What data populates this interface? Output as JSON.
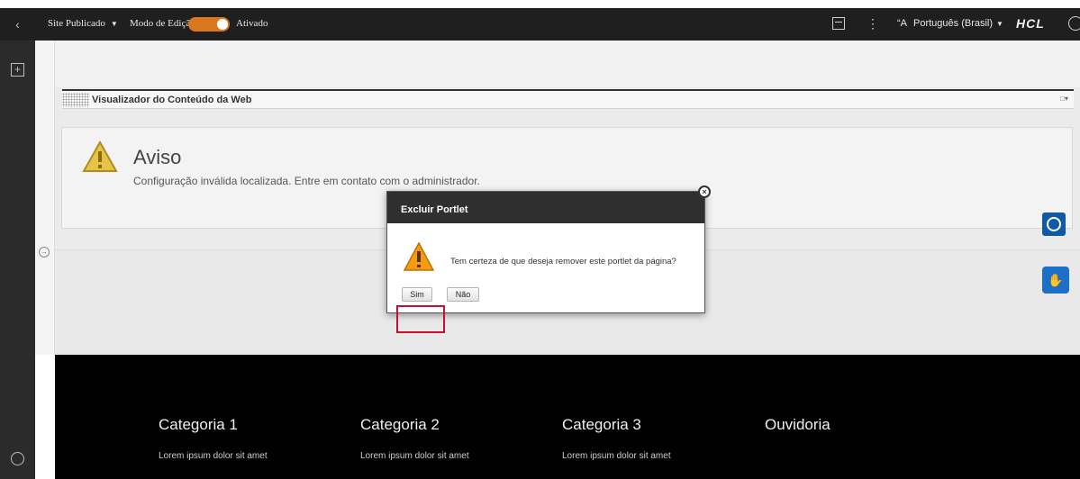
{
  "toolbar": {
    "back_icon": "chevron-left-icon",
    "site_label": "Site Publicado",
    "mode_label": "Modo de Edição:",
    "mode_state": "Ativado",
    "toggle_color": "#d9771f",
    "language": "Português (Brasil)",
    "logo": "HCL"
  },
  "portlet": {
    "title": "Visualizador do Conteúdo da Web"
  },
  "warning": {
    "title": "Aviso",
    "message": "Configuração inválida localizada. Entre em contato com o administrador."
  },
  "dialog": {
    "title": "Excluir Portlet",
    "message": "Tem certeza de que deseja remover este portlet da página?",
    "yes_label": "Sim",
    "no_label": "Não"
  },
  "footer": {
    "columns": [
      {
        "title": "Categoria 1",
        "link": "Lorem ipsum dolor sit amet"
      },
      {
        "title": "Categoria 2",
        "link": "Lorem ipsum dolor sit amet"
      },
      {
        "title": "Categoria 3",
        "link": "Lorem ipsum dolor sit amet"
      },
      {
        "title": "Ouvidoria",
        "link": ""
      }
    ]
  },
  "colors": {
    "toolbar_bg": "#1f1f1f",
    "accent_blue": "#0e5aa7",
    "highlight_red": "#c8102e"
  }
}
